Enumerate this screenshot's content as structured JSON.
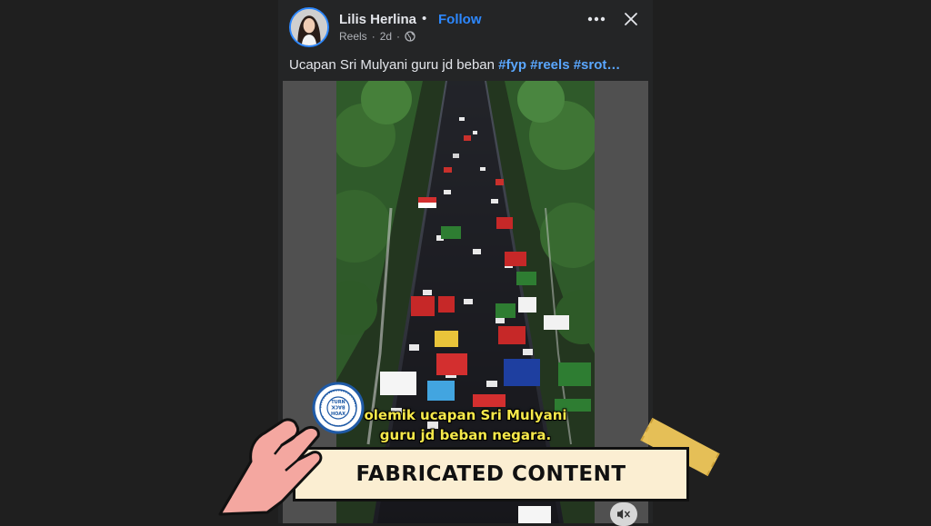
{
  "post": {
    "author": "Lilis Herlina",
    "separator": "•",
    "follow_label": "Follow",
    "meta_source": "Reels",
    "meta_dot": "·",
    "meta_time": "2d",
    "more_icon": "more-horizontal-icon",
    "close_icon": "close-icon",
    "caption_text": "Ucapan Sri Mulyani guru jd beban ",
    "hashtags": [
      "#fyp",
      "#reels",
      "#srot…"
    ]
  },
  "video": {
    "subtitle_line1": "olemik ucapan Sri Mulyani",
    "subtitle_line2": "guru jd beban negara.",
    "mute_icon": "muted-speaker-icon"
  },
  "overlay": {
    "stamp_label": "FABRICATED CONTENT",
    "seal_text_center": [
      "TURN",
      "BACK",
      "HOAX"
    ],
    "seal_ring_text": "MASYARAKAT ANTI FITNAH INDONESIA • MAFINDO",
    "colors": {
      "banner_bg": "#fbeed2",
      "tape": "#f0c85a",
      "hand": "#f4a7a0",
      "seal": "#1f5aa6"
    }
  },
  "colors": {
    "accent": "#2d88ff",
    "hashtag": "#5aa7ff",
    "subtitle": "#f5e84a"
  }
}
